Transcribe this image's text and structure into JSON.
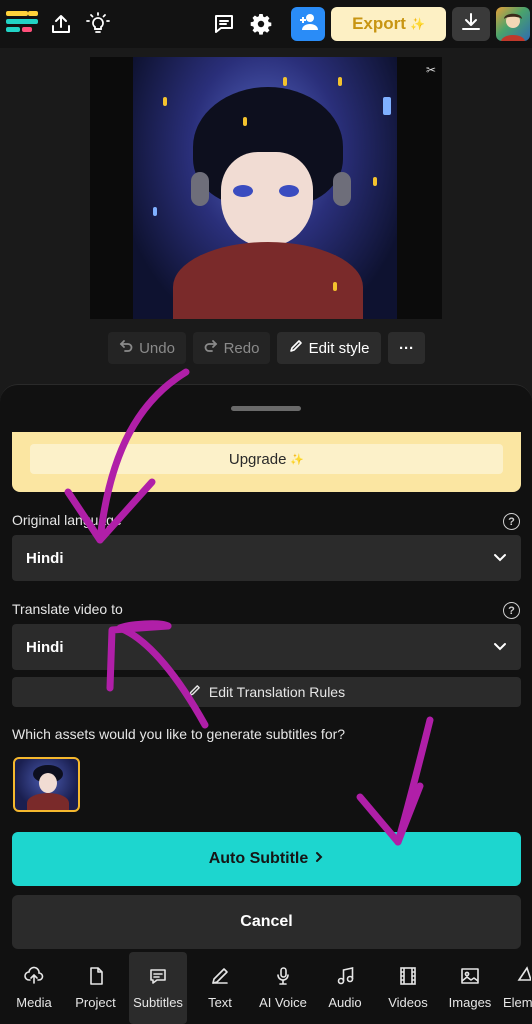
{
  "topbar": {
    "logo_icon": "logo-icon",
    "upload_icon": "upload-icon",
    "idea_icon": "lightbulb-icon",
    "comment_icon": "comment-icon",
    "settings_icon": "gear-icon",
    "add_user_icon": "add-user-icon",
    "export_label": "Export",
    "export_sparkle": "✨",
    "download_icon": "download-icon",
    "colors": {
      "adduser": "#2a8cf7",
      "export_bg": "#fdf0c4",
      "export_text": "#c89512"
    }
  },
  "preview": {
    "corner_mark": "✂"
  },
  "toolbar": {
    "undo_label": "Undo",
    "redo_label": "Redo",
    "edit_style_label": "Edit style",
    "more_label": "···"
  },
  "sheet": {
    "upgrade_label": "Upgrade",
    "upgrade_sparkle": "✨",
    "original_language_label": "Original language",
    "original_language_value": "Hindi",
    "translate_label": "Translate video to",
    "translate_value": "Hindi",
    "help_glyph": "?",
    "edit_rules_label": "Edit Translation Rules",
    "assets_question": "Which assets would you like to generate subtitles for?",
    "auto_subtitle_label": "Auto Subtitle",
    "cancel_label": "Cancel",
    "colors": {
      "accent": "#1dd6cf",
      "upgrade_bg": "#fbe6a2",
      "asset_border": "#f5b82e"
    }
  },
  "bottom_nav": {
    "items": [
      {
        "label": "Media",
        "icon": "media-upload-icon"
      },
      {
        "label": "Project",
        "icon": "file-icon"
      },
      {
        "label": "Subtitles",
        "icon": "subtitles-icon"
      },
      {
        "label": "Text",
        "icon": "pen-icon"
      },
      {
        "label": "AI Voice",
        "icon": "microphone-icon"
      },
      {
        "label": "Audio",
        "icon": "music-icon"
      },
      {
        "label": "Videos",
        "icon": "film-icon"
      },
      {
        "label": "Images",
        "icon": "image-icon"
      },
      {
        "label": "Elem",
        "icon": "shapes-icon"
      }
    ],
    "active": "Subtitles"
  },
  "annotations": {
    "arrow_color": "#b01fa8"
  }
}
